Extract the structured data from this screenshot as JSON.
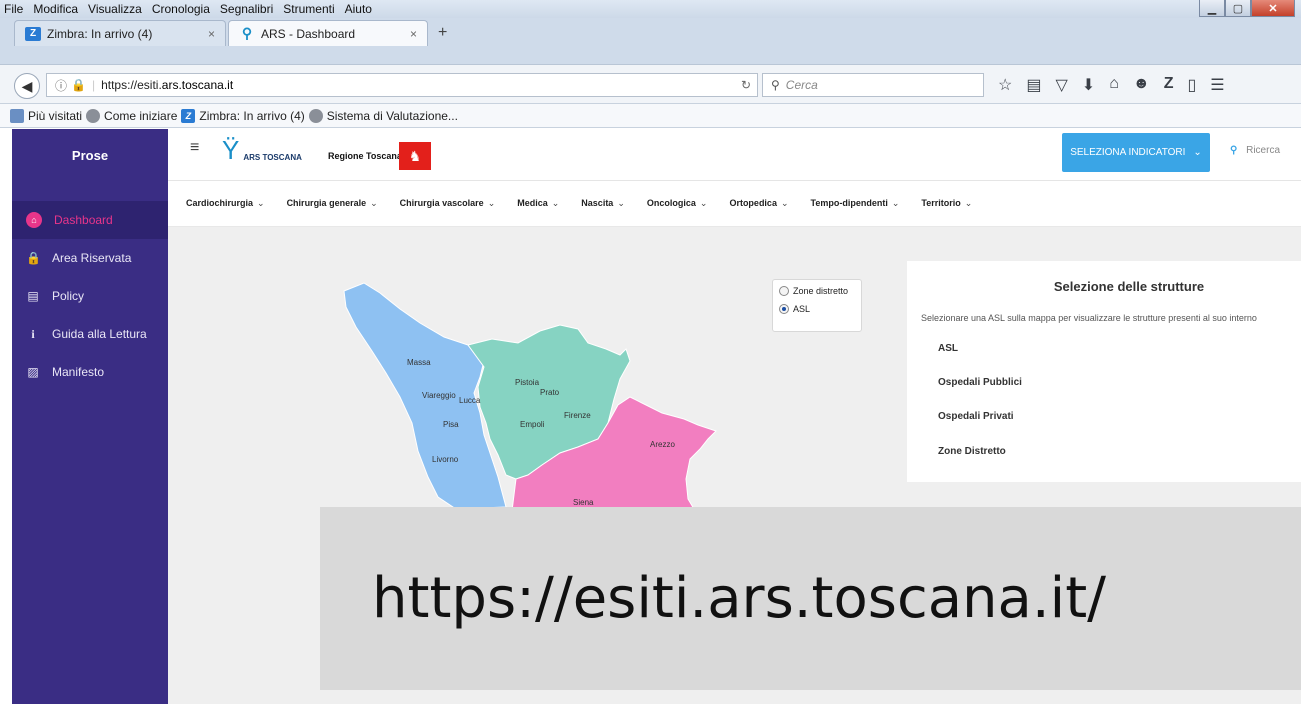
{
  "browser": {
    "menu": [
      "File",
      "Modifica",
      "Visualizza",
      "Cronologia",
      "Segnalibri",
      "Strumenti",
      "Aiuto"
    ],
    "tabs": [
      {
        "label": "Zimbra: In arrivo (4)",
        "active": false
      },
      {
        "label": "ARS - Dashboard",
        "active": true
      }
    ],
    "url_prefix": "https://esiti.",
    "url_host": "ars.toscana.it",
    "search_placeholder": "Cerca",
    "bookmarks": [
      "Più visitati",
      "Come iniziare",
      "Zimbra: In arrivo (4)",
      "Sistema di Valutazione..."
    ]
  },
  "sidebar": {
    "brand": "Prose",
    "items": [
      {
        "label": "Dashboard",
        "icon": "home-icon",
        "active": true
      },
      {
        "label": "Area Riservata",
        "icon": "lock-icon"
      },
      {
        "label": "Policy",
        "icon": "document-icon"
      },
      {
        "label": "Guida alla Lettura",
        "icon": "info-icon"
      },
      {
        "label": "Manifesto",
        "icon": "pdf-icon"
      }
    ]
  },
  "header": {
    "ars_logo_text": "ARS TOSCANA",
    "regione": "Regione Toscana",
    "select_button": "SELEZIONA INDICATORI",
    "search_label": "Ricerca"
  },
  "categories": [
    "Cardiochirurgia",
    "Chirurgia generale",
    "Chirurgia vascolare",
    "Medica",
    "Nascita",
    "Oncologica",
    "Ortopedica",
    "Tempo-dipendenti",
    "Territorio"
  ],
  "map": {
    "options": [
      {
        "label": "Zone distretto",
        "selected": false
      },
      {
        "label": "ASL",
        "selected": true
      }
    ],
    "colors": {
      "nord_ovest": "#8ec1f2",
      "centro": "#86d3c2",
      "sud_est": "#f27ec0"
    },
    "cities": [
      "Massa",
      "Viareggio",
      "Lucca",
      "Pisa",
      "Livorno",
      "Pistoia",
      "Prato",
      "Firenze",
      "Empoli",
      "Arezzo",
      "Siena"
    ]
  },
  "panel": {
    "title": "Selezione delle strutture",
    "description": "Selezionare una ASL sulla mappa per visualizzare le strutture presenti al suo interno",
    "rows": [
      "ASL",
      "Ospedali Pubblici",
      "Ospedali Privati",
      "Zone Distretto"
    ]
  },
  "overlay": {
    "text": "https://esiti.ars.toscana.it/"
  }
}
